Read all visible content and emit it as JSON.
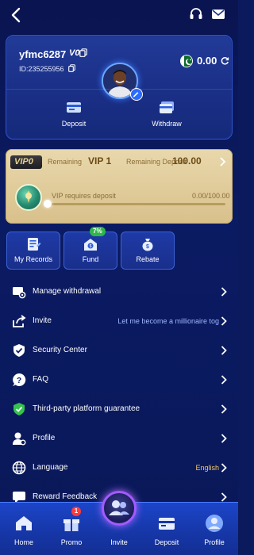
{
  "colors": {
    "background": "#0b1a5c",
    "card_blue": "#1a2f86",
    "vip_gold": "#d8c08b",
    "accent_gold": "#f2c763",
    "link_blue": "#9fb6ff",
    "nav_blue": "#1636a6",
    "invite_glow": "#a25bff",
    "badge_green": "#2fb84a",
    "badge_red": "#ff3b3b"
  },
  "topbar": {
    "back_icon": "chevron-left-icon",
    "support_icon": "headset-icon",
    "mail_icon": "envelope-icon"
  },
  "profile": {
    "username": "yfmc6287",
    "vip_tag": "V0",
    "user_id": "ID:235255956",
    "balance": "0.00",
    "currency_icon": "pakistan-flag-icon",
    "refresh_icon": "refresh-icon",
    "avatar_icon": "avatar-icon",
    "edit_icon": "pencil-icon",
    "actions": [
      {
        "label": "Deposit",
        "icon": "deposit-card-icon"
      },
      {
        "label": "Withdraw",
        "icon": "withdraw-card-icon"
      }
    ]
  },
  "vip": {
    "badge": "VIP0",
    "remaining_label": "Remaining",
    "next_level": "VIP 1",
    "remaining_deposit_label": "Remaining Deposit",
    "remaining_deposit": "100.00",
    "requires_text": "VIP requires deposit",
    "progress_text": "0.00/100.00",
    "progress_fraction": 0.0,
    "medal_icon": "vip-medal-icon"
  },
  "quick_actions": [
    {
      "label": "My Records",
      "icon": "records-icon"
    },
    {
      "label": "Fund",
      "icon": "fund-icon",
      "badge": "7%"
    },
    {
      "label": "Rebate",
      "icon": "rebate-icon"
    }
  ],
  "menu": [
    {
      "label": "Manage withdrawal",
      "icon": "wallet-gear-icon",
      "value": ""
    },
    {
      "label": "Invite",
      "icon": "share-icon",
      "value": "Let me become a millionaire tog"
    },
    {
      "label": "Security Center",
      "icon": "shield-check-icon",
      "value": ""
    },
    {
      "label": "FAQ",
      "icon": "question-icon",
      "value": ""
    },
    {
      "label": "Third-party platform guarantee",
      "icon": "green-shield-icon",
      "value": ""
    },
    {
      "label": "Profile",
      "icon": "user-gear-icon",
      "value": ""
    },
    {
      "label": "Language",
      "icon": "globe-icon",
      "value": "English"
    },
    {
      "label": "Reward Feedback",
      "icon": "feedback-icon",
      "value": ""
    }
  ],
  "bottom_nav": [
    {
      "label": "Home",
      "icon": "home-icon"
    },
    {
      "label": "Promo",
      "icon": "gift-icon",
      "badge": "1"
    },
    {
      "label": "Invite",
      "icon": "invite-users-icon"
    },
    {
      "label": "Deposit",
      "icon": "deposit-icon"
    },
    {
      "label": "Profile",
      "icon": "profile-icon"
    }
  ]
}
